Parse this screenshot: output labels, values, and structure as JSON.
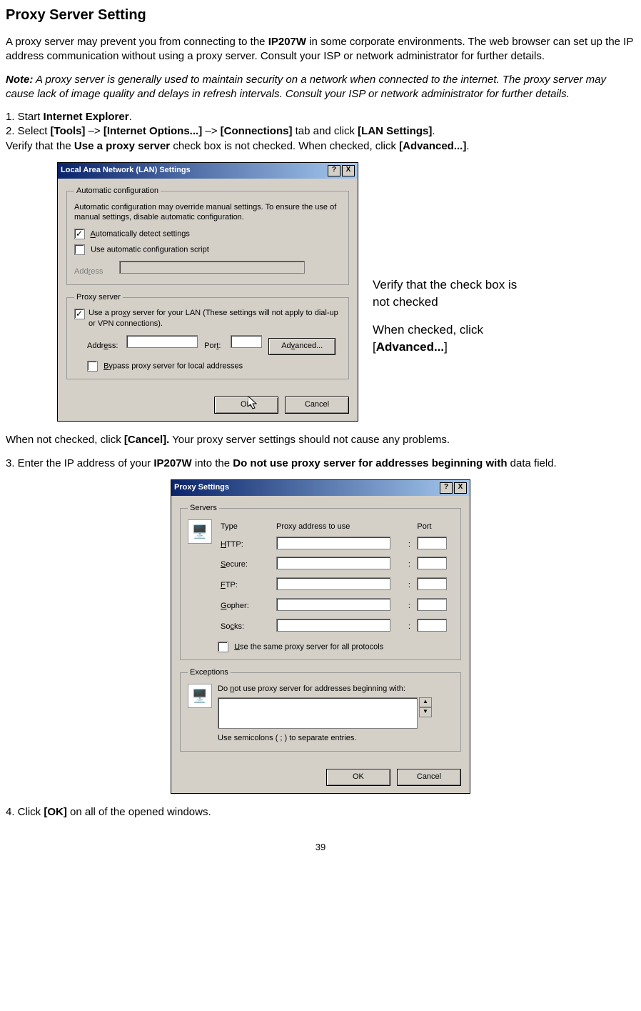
{
  "title": "Proxy Server Setting",
  "intro": {
    "pre": "A proxy server may prevent you from connecting to the ",
    "device": "IP207W",
    "post": " in some corporate environments. The web browser can set up the IP address communication without using a proxy server. Consult your ISP or network administrator for further details."
  },
  "note": {
    "label": "Note:",
    "text": " A proxy server is generally used to maintain security on a network when connected to the internet. The proxy server may cause lack of image quality and delays in refresh intervals. Consult your ISP or network administrator for further details."
  },
  "step1": {
    "pre": "1. Start ",
    "b": "Internet Explorer",
    "post": "."
  },
  "step2": {
    "pre": "2. Select ",
    "b1": "[Tools]",
    "a1": " –> ",
    "b2": "[Internet Options...]",
    "a2": " –> ",
    "b3": "[Connections]",
    "a3": " tab and click ",
    "b4": "[LAN Settings]",
    "post": "."
  },
  "verify": {
    "pre": "Verify that the ",
    "b1": "Use a proxy server",
    "mid": " check box is not checked. When checked, click ",
    "b2": "[Advanced...]",
    "post": "."
  },
  "dialog1": {
    "title": "Local Area Network (LAN) Settings",
    "help": "?",
    "close": "X",
    "group1": {
      "legend": "Automatic configuration",
      "desc": "Automatic configuration may override manual settings. To ensure the use of manual settings, disable automatic configuration.",
      "cb1": "Automatically detect settings",
      "cb2": "Use automatic configuration script",
      "addr_label": "Address"
    },
    "group2": {
      "legend": "Proxy server",
      "cb": "Use a proxy server for your LAN (These settings will not apply to dial-up or VPN connections).",
      "addr_label": "Address:",
      "port_label": "Port:",
      "advanced": "Advanced...",
      "bypass": "Bypass proxy server for local addresses"
    },
    "ok": "OK",
    "cancel": "Cancel"
  },
  "callout": {
    "l1": "Verify that the check box is not checked",
    "l2a": "When checked, click ",
    "l2b": "[Advanced...]"
  },
  "after1": {
    "pre": "When not checked, click ",
    "b": "[Cancel].",
    "post": " Your proxy server settings should not cause any problems."
  },
  "step3": {
    "pre": "3. Enter the IP address of your ",
    "b1": "IP207W",
    "mid": " into the ",
    "b2": "Do not use proxy server for addresses beginning with",
    "post": " data field."
  },
  "dialog2": {
    "title": "Proxy Settings",
    "help": "?",
    "close": "X",
    "servers": {
      "legend": "Servers",
      "type": "Type",
      "addr": "Proxy address to use",
      "port": "Port",
      "http": "HTTP:",
      "secure": "Secure:",
      "ftp": "FTP:",
      "gopher": "Gopher:",
      "socks": "Socks:",
      "same": "Use the same proxy server for all protocols"
    },
    "exceptions": {
      "legend": "Exceptions",
      "label": "Do not use proxy server for addresses beginning with:",
      "hint": "Use semicolons ( ; ) to separate entries."
    },
    "ok": "OK",
    "cancel": "Cancel"
  },
  "step4": {
    "pre": "4. Click ",
    "b": "[OK]",
    "post": " on all of the opened windows."
  },
  "page": "39"
}
